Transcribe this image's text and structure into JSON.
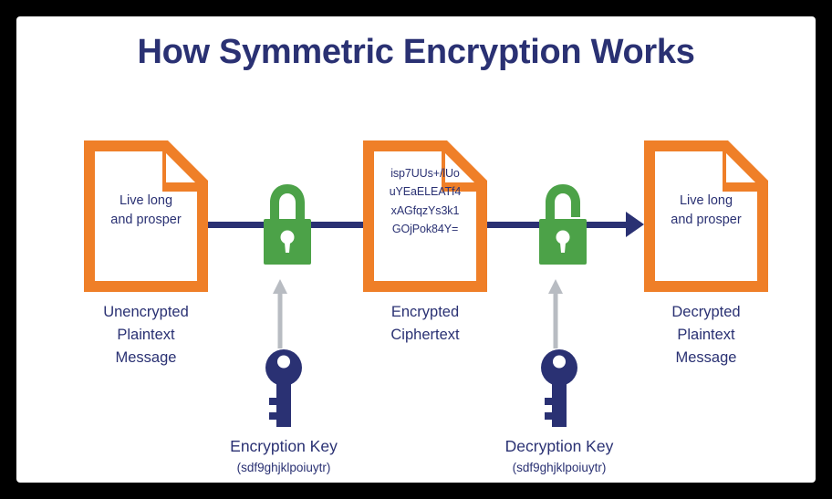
{
  "diagram": {
    "title": "How Symmetric Encryption Works",
    "colors": {
      "navy": "#2a3173",
      "orange": "#ef7f28",
      "green": "#4ca248",
      "gray": "#b8bcc2",
      "border": "#000000",
      "background": "#ffffff"
    },
    "documents": [
      {
        "id": "plaintext-input",
        "lines": [
          "Live long",
          "and prosper"
        ],
        "caption": [
          "Unencrypted",
          "Plaintext",
          "Message"
        ],
        "kind": "plaintext"
      },
      {
        "id": "ciphertext",
        "lines": [
          "isp7UUs+/lUo",
          "uYEaELEATf4",
          "xAGfqzYs3k1",
          "GOjPok84Y="
        ],
        "caption": [
          "Encrypted",
          "Ciphertext"
        ],
        "kind": "ciphertext"
      },
      {
        "id": "plaintext-output",
        "lines": [
          "Live long",
          "and prosper"
        ],
        "caption": [
          "Decrypted",
          "Plaintext",
          "Message"
        ],
        "kind": "plaintext"
      }
    ],
    "locks": [
      {
        "id": "encrypt-lock",
        "state": "closed",
        "label": "closed-padlock-icon"
      },
      {
        "id": "decrypt-lock",
        "state": "open",
        "label": "open-padlock-icon"
      }
    ],
    "keys": [
      {
        "id": "encryption-key",
        "title": "Encryption Key",
        "value": "(sdf9ghjklpoiuytr)"
      },
      {
        "id": "decryption-key",
        "title": "Decryption Key",
        "value": "(sdf9ghjklpoiuytr)"
      }
    ],
    "flow": {
      "direction": "left-to-right",
      "arrow_color": "#2a3173"
    }
  }
}
